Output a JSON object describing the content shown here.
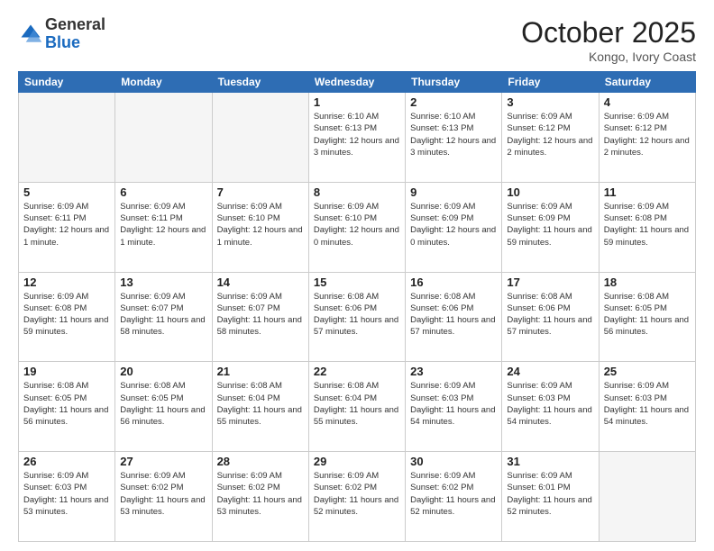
{
  "header": {
    "logo_general": "General",
    "logo_blue": "Blue",
    "month_title": "October 2025",
    "location": "Kongo, Ivory Coast"
  },
  "days_of_week": [
    "Sunday",
    "Monday",
    "Tuesday",
    "Wednesday",
    "Thursday",
    "Friday",
    "Saturday"
  ],
  "weeks": [
    [
      {
        "day": "",
        "info": ""
      },
      {
        "day": "",
        "info": ""
      },
      {
        "day": "",
        "info": ""
      },
      {
        "day": "1",
        "info": "Sunrise: 6:10 AM\nSunset: 6:13 PM\nDaylight: 12 hours and 3 minutes."
      },
      {
        "day": "2",
        "info": "Sunrise: 6:10 AM\nSunset: 6:13 PM\nDaylight: 12 hours and 3 minutes."
      },
      {
        "day": "3",
        "info": "Sunrise: 6:09 AM\nSunset: 6:12 PM\nDaylight: 12 hours and 2 minutes."
      },
      {
        "day": "4",
        "info": "Sunrise: 6:09 AM\nSunset: 6:12 PM\nDaylight: 12 hours and 2 minutes."
      }
    ],
    [
      {
        "day": "5",
        "info": "Sunrise: 6:09 AM\nSunset: 6:11 PM\nDaylight: 12 hours and 1 minute."
      },
      {
        "day": "6",
        "info": "Sunrise: 6:09 AM\nSunset: 6:11 PM\nDaylight: 12 hours and 1 minute."
      },
      {
        "day": "7",
        "info": "Sunrise: 6:09 AM\nSunset: 6:10 PM\nDaylight: 12 hours and 1 minute."
      },
      {
        "day": "8",
        "info": "Sunrise: 6:09 AM\nSunset: 6:10 PM\nDaylight: 12 hours and 0 minutes."
      },
      {
        "day": "9",
        "info": "Sunrise: 6:09 AM\nSunset: 6:09 PM\nDaylight: 12 hours and 0 minutes."
      },
      {
        "day": "10",
        "info": "Sunrise: 6:09 AM\nSunset: 6:09 PM\nDaylight: 11 hours and 59 minutes."
      },
      {
        "day": "11",
        "info": "Sunrise: 6:09 AM\nSunset: 6:08 PM\nDaylight: 11 hours and 59 minutes."
      }
    ],
    [
      {
        "day": "12",
        "info": "Sunrise: 6:09 AM\nSunset: 6:08 PM\nDaylight: 11 hours and 59 minutes."
      },
      {
        "day": "13",
        "info": "Sunrise: 6:09 AM\nSunset: 6:07 PM\nDaylight: 11 hours and 58 minutes."
      },
      {
        "day": "14",
        "info": "Sunrise: 6:09 AM\nSunset: 6:07 PM\nDaylight: 11 hours and 58 minutes."
      },
      {
        "day": "15",
        "info": "Sunrise: 6:08 AM\nSunset: 6:06 PM\nDaylight: 11 hours and 57 minutes."
      },
      {
        "day": "16",
        "info": "Sunrise: 6:08 AM\nSunset: 6:06 PM\nDaylight: 11 hours and 57 minutes."
      },
      {
        "day": "17",
        "info": "Sunrise: 6:08 AM\nSunset: 6:06 PM\nDaylight: 11 hours and 57 minutes."
      },
      {
        "day": "18",
        "info": "Sunrise: 6:08 AM\nSunset: 6:05 PM\nDaylight: 11 hours and 56 minutes."
      }
    ],
    [
      {
        "day": "19",
        "info": "Sunrise: 6:08 AM\nSunset: 6:05 PM\nDaylight: 11 hours and 56 minutes."
      },
      {
        "day": "20",
        "info": "Sunrise: 6:08 AM\nSunset: 6:05 PM\nDaylight: 11 hours and 56 minutes."
      },
      {
        "day": "21",
        "info": "Sunrise: 6:08 AM\nSunset: 6:04 PM\nDaylight: 11 hours and 55 minutes."
      },
      {
        "day": "22",
        "info": "Sunrise: 6:08 AM\nSunset: 6:04 PM\nDaylight: 11 hours and 55 minutes."
      },
      {
        "day": "23",
        "info": "Sunrise: 6:09 AM\nSunset: 6:03 PM\nDaylight: 11 hours and 54 minutes."
      },
      {
        "day": "24",
        "info": "Sunrise: 6:09 AM\nSunset: 6:03 PM\nDaylight: 11 hours and 54 minutes."
      },
      {
        "day": "25",
        "info": "Sunrise: 6:09 AM\nSunset: 6:03 PM\nDaylight: 11 hours and 54 minutes."
      }
    ],
    [
      {
        "day": "26",
        "info": "Sunrise: 6:09 AM\nSunset: 6:03 PM\nDaylight: 11 hours and 53 minutes."
      },
      {
        "day": "27",
        "info": "Sunrise: 6:09 AM\nSunset: 6:02 PM\nDaylight: 11 hours and 53 minutes."
      },
      {
        "day": "28",
        "info": "Sunrise: 6:09 AM\nSunset: 6:02 PM\nDaylight: 11 hours and 53 minutes."
      },
      {
        "day": "29",
        "info": "Sunrise: 6:09 AM\nSunset: 6:02 PM\nDaylight: 11 hours and 52 minutes."
      },
      {
        "day": "30",
        "info": "Sunrise: 6:09 AM\nSunset: 6:02 PM\nDaylight: 11 hours and 52 minutes."
      },
      {
        "day": "31",
        "info": "Sunrise: 6:09 AM\nSunset: 6:01 PM\nDaylight: 11 hours and 52 minutes."
      },
      {
        "day": "",
        "info": ""
      }
    ]
  ]
}
